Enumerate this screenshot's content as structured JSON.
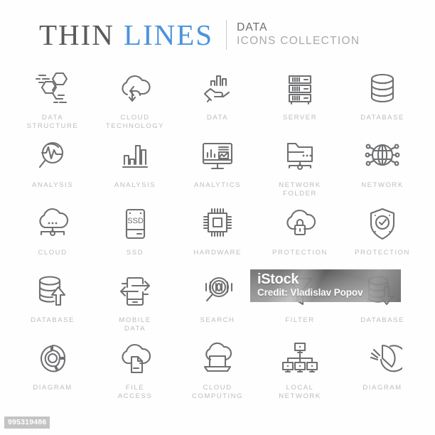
{
  "header": {
    "title_part1": "THIN",
    "title_part2": "LINES",
    "subtitle_line1": "DATA",
    "subtitle_line2": "ICONS COLLECTION",
    "accent_color": "#4a93dd",
    "title_color": "#5a5a5c",
    "subtitle_color": "#a9a9ac"
  },
  "icons": [
    {
      "icon": "data-structure-icon",
      "label": "DATA\nSTRUCTURE"
    },
    {
      "icon": "cloud-technology-icon",
      "label": "CLOUD\nTECHNOLOGY"
    },
    {
      "icon": "data-hand-icon",
      "label": "DATA"
    },
    {
      "icon": "server-icon",
      "label": "SERVER"
    },
    {
      "icon": "database-icon",
      "label": "DATABASE"
    },
    {
      "icon": "analysis-magnifier-icon",
      "label": "ANALYSIS"
    },
    {
      "icon": "analysis-barchart-icon",
      "label": "ANALYSIS"
    },
    {
      "icon": "analytics-monitor-icon",
      "label": "ANALYTICS"
    },
    {
      "icon": "network-folder-icon",
      "label": "NETWORK\nFOLDER"
    },
    {
      "icon": "network-globe-icon",
      "label": "NETWORK"
    },
    {
      "icon": "cloud-icon",
      "label": "CLOUD"
    },
    {
      "icon": "ssd-icon",
      "label": "SSD"
    },
    {
      "icon": "hardware-chip-icon",
      "label": "HARDWARE"
    },
    {
      "icon": "cloud-protection-icon",
      "label": "PROTECTION"
    },
    {
      "icon": "shield-protection-icon",
      "label": "PROTECTION"
    },
    {
      "icon": "database-upload-icon",
      "label": "DATABASE"
    },
    {
      "icon": "mobile-data-icon",
      "label": "MOBILE\nDATA"
    },
    {
      "icon": "search-binary-icon",
      "label": "SEARCH"
    },
    {
      "icon": "filter-funnel-icon",
      "label": "FILTER"
    },
    {
      "icon": "database-download-icon",
      "label": "DATABASE"
    },
    {
      "icon": "diagram-donut-icon",
      "label": "DIAGRAM"
    },
    {
      "icon": "file-access-icon",
      "label": "FILE\nACCESS"
    },
    {
      "icon": "cloud-computing-icon",
      "label": "CLOUD\nCOMPUTING"
    },
    {
      "icon": "local-network-icon",
      "label": "LOCAL\nNETWORK"
    },
    {
      "icon": "diagram-pie-icon",
      "label": "DIAGRAM"
    }
  ],
  "watermark": {
    "brand": "iStock",
    "credit": "Credit: Vladislav Popov",
    "image_id": "995319486"
  }
}
